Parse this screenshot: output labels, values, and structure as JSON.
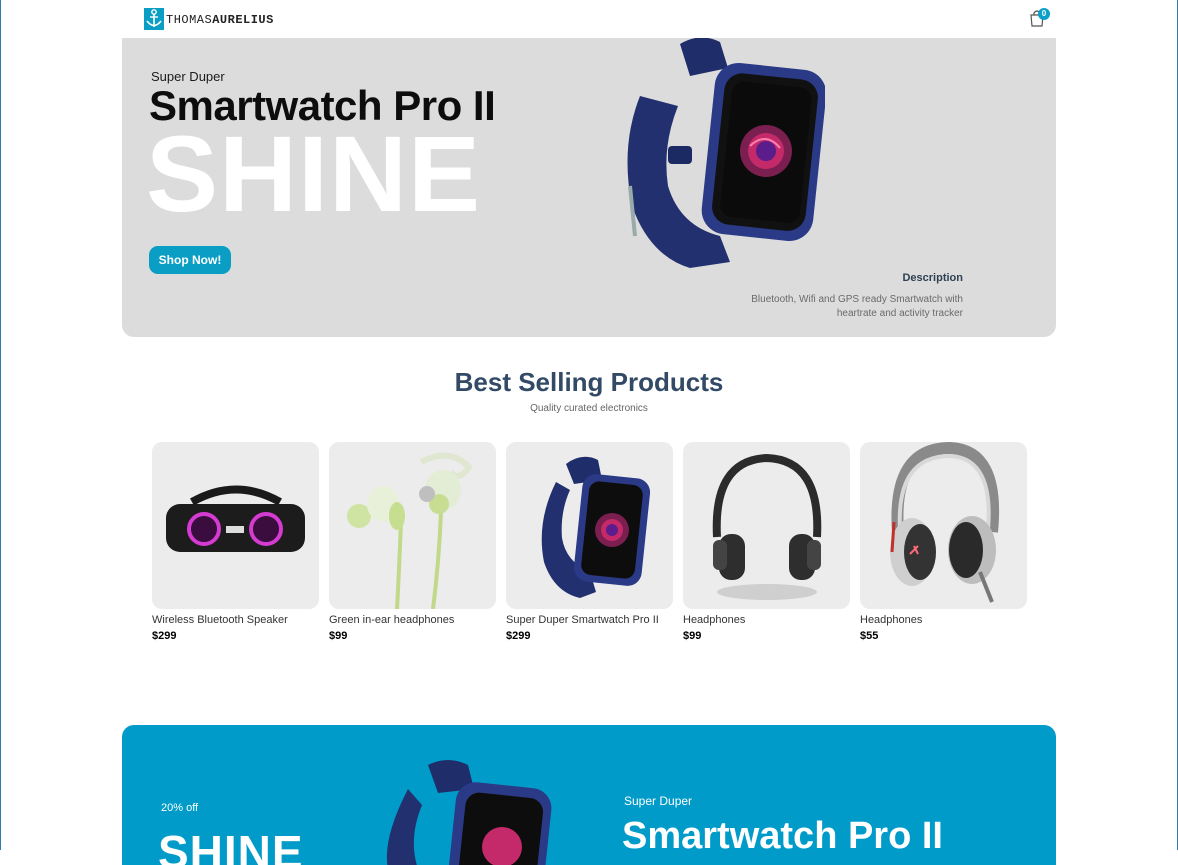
{
  "header": {
    "logo_text_light": "THOMAS",
    "logo_text_bold": "AURELIUS",
    "cart_count": "0",
    "cart_icon": "shopping-bag-icon"
  },
  "hero": {
    "small_text": "Super Duper",
    "title": "Smartwatch Pro II",
    "big_text": "SHINE",
    "button_label": "Shop Now!",
    "description_title": "Description",
    "description_text": "Bluetooth, Wifi and GPS ready Smartwatch with heartrate and activity tracker",
    "background": "#dcdcdc",
    "accent": "#0a9ec5"
  },
  "best_selling": {
    "title": "Best Selling Products",
    "subtitle": "Quality curated electronics",
    "products": [
      {
        "name": "Wireless Bluetooth Speaker",
        "price": "$299",
        "icon": "speaker-image"
      },
      {
        "name": "Green in-ear headphones",
        "price": "$99",
        "icon": "earphones-image"
      },
      {
        "name": "Super Duper Smartwatch Pro II",
        "price": "$299",
        "icon": "smartwatch-image"
      },
      {
        "name": "Headphones",
        "price": "$99",
        "icon": "headphones-image"
      },
      {
        "name": "Headphones",
        "price": "$55",
        "icon": "headphones-image"
      }
    ]
  },
  "banner": {
    "discount": "20% off",
    "big_text": "SHINE",
    "small_text": "Super Duper",
    "title": "Smartwatch Pro II",
    "background": "#009bc8"
  }
}
